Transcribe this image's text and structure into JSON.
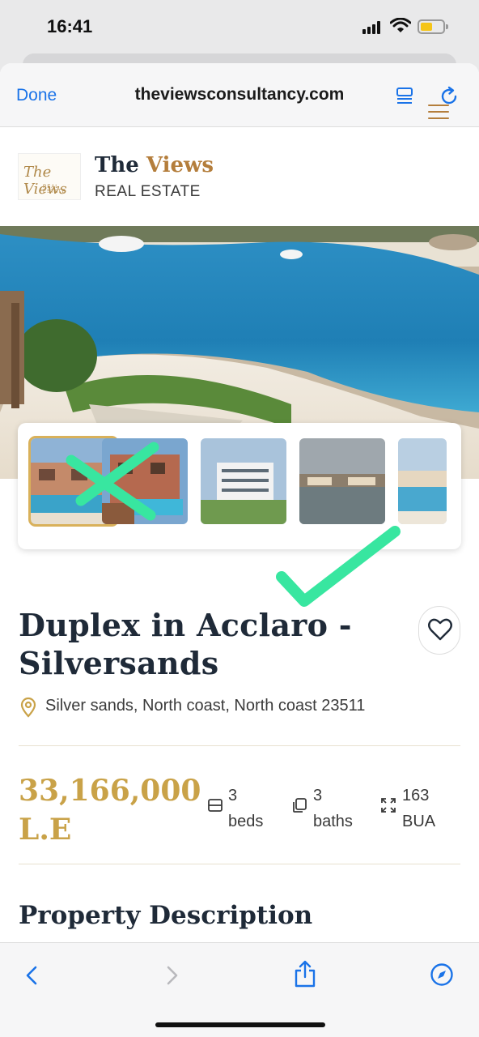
{
  "status_bar": {
    "time": "16:41"
  },
  "browser": {
    "done_label": "Done",
    "url": "theviewsconsultancy.com"
  },
  "site": {
    "logo_text": "The Views",
    "logo_subtext": "REAL ESTATE",
    "brand_first": "The ",
    "brand_accent": "Views",
    "brand_sub": "REAL ESTATE",
    "accent_color": "#b47e3c"
  },
  "gallery": {
    "thumbnail_count": 5,
    "active_index": 0
  },
  "listing": {
    "title": "Duplex in Acclaro - Silversands",
    "location": "Silver sands, North coast, North coast 23511",
    "price": "33,166,000 L.E",
    "beds_value": "3",
    "beds_label": "beds",
    "baths_value": "3",
    "baths_label": "baths",
    "area_value": "163",
    "area_label": "BUA",
    "price_color": "#c9a248"
  },
  "sections": {
    "description_title": "Property Description"
  },
  "icons": {
    "reader": "reader-icon",
    "reload": "reload-icon",
    "menu": "hamburger-menu-icon",
    "favorite": "heart-icon",
    "location": "location-pin-icon",
    "beds": "bed-icon",
    "baths": "bath-icon",
    "area": "expand-icon",
    "back": "back-arrow-icon",
    "forward": "forward-arrow-icon",
    "share": "share-icon",
    "compass": "compass-icon"
  }
}
